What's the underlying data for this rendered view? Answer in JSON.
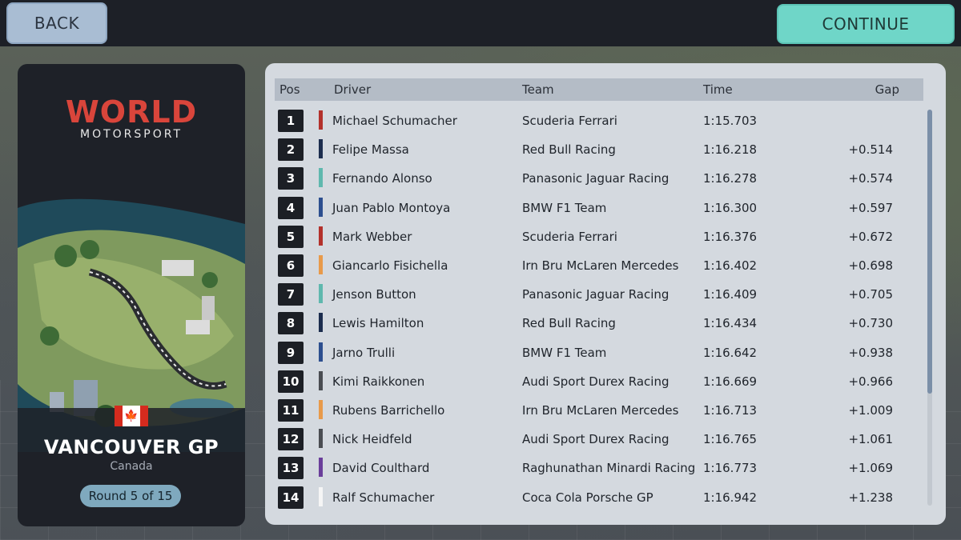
{
  "nav": {
    "back_label": "BACK",
    "continue_label": "CONTINUE"
  },
  "event": {
    "logo_top": "WORLD",
    "logo_bottom": "MOTORSPORT",
    "gp_name": "VANCOUVER GP",
    "country": "Canada",
    "flag_icon": "canada-flag-icon",
    "round_label": "Round 5 of 15"
  },
  "results": {
    "headers": {
      "pos": "Pos",
      "driver": "Driver",
      "team": "Team",
      "time": "Time",
      "gap": "Gap"
    },
    "rows": [
      {
        "pos": "1",
        "driver": "Michael Schumacher",
        "team": "Scuderia Ferrari",
        "time": "1:15.703",
        "gap": "",
        "color": "#b3312b"
      },
      {
        "pos": "2",
        "driver": "Felipe Massa",
        "team": "Red Bull Racing",
        "time": "1:16.218",
        "gap": "+0.514",
        "color": "#1c2d4e"
      },
      {
        "pos": "3",
        "driver": "Fernando Alonso",
        "team": "Panasonic Jaguar Racing",
        "time": "1:16.278",
        "gap": "+0.574",
        "color": "#5fb8ae"
      },
      {
        "pos": "4",
        "driver": "Juan Pablo Montoya",
        "team": "BMW F1 Team",
        "time": "1:16.300",
        "gap": "+0.597",
        "color": "#2d4f8f"
      },
      {
        "pos": "5",
        "driver": "Mark Webber",
        "team": "Scuderia Ferrari",
        "time": "1:16.376",
        "gap": "+0.672",
        "color": "#b3312b"
      },
      {
        "pos": "6",
        "driver": "Giancarlo Fisichella",
        "team": "Irn Bru McLaren Mercedes",
        "time": "1:16.402",
        "gap": "+0.698",
        "color": "#e89a4a"
      },
      {
        "pos": "7",
        "driver": "Jenson Button",
        "team": "Panasonic Jaguar Racing",
        "time": "1:16.409",
        "gap": "+0.705",
        "color": "#5fb8ae"
      },
      {
        "pos": "8",
        "driver": "Lewis Hamilton",
        "team": "Red Bull Racing",
        "time": "1:16.434",
        "gap": "+0.730",
        "color": "#1c2d4e"
      },
      {
        "pos": "9",
        "driver": "Jarno Trulli",
        "team": "BMW F1 Team",
        "time": "1:16.642",
        "gap": "+0.938",
        "color": "#2d4f8f"
      },
      {
        "pos": "10",
        "driver": "Kimi Raikkonen",
        "team": "Audi Sport Durex Racing",
        "time": "1:16.669",
        "gap": "+0.966",
        "color": "#4a4d52"
      },
      {
        "pos": "11",
        "driver": "Rubens Barrichello",
        "team": "Irn Bru McLaren Mercedes",
        "time": "1:16.713",
        "gap": "+1.009",
        "color": "#e89a4a"
      },
      {
        "pos": "12",
        "driver": "Nick Heidfeld",
        "team": "Audi Sport Durex Racing",
        "time": "1:16.765",
        "gap": "+1.061",
        "color": "#4a4d52"
      },
      {
        "pos": "13",
        "driver": "David Coulthard",
        "team": "Raghunathan Minardi Racing",
        "time": "1:16.773",
        "gap": "+1.069",
        "color": "#6a3e9a"
      },
      {
        "pos": "14",
        "driver": "Ralf Schumacher",
        "team": "Coca Cola Porsche GP",
        "time": "1:16.942",
        "gap": "+1.238",
        "color": "#f5f5f5"
      }
    ]
  }
}
